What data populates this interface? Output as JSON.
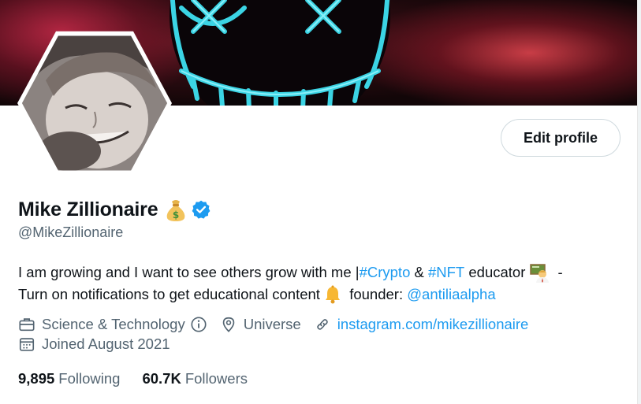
{
  "profile": {
    "display_name": "Mike Zillionaire",
    "handle": "@MikeZillionaire",
    "edit_button_label": "Edit profile",
    "name_emoji_icon": "money-bag-emoji",
    "verified_icon": "verified-badge-icon"
  },
  "bio": {
    "line1_text1": "I am growing and I want to see others grow with me | ",
    "hashtag_crypto": "#Crypto",
    "amp": " & ",
    "hashtag_nft": "#NFT",
    "line1_text2": " educator",
    "line1_emoji_icon": "teacher-emoji",
    "line1_text3": " -",
    "line2_text1": "Turn on notifications to get educational content ",
    "line2_emoji_icon": "bell-emoji",
    "line2_text2": " founder: ",
    "mention": "@antiliaalpha"
  },
  "meta": {
    "category": "Science & Technology",
    "location": "Universe",
    "website": "instagram.com/mikezillionaire",
    "joined": "Joined August 2021"
  },
  "stats": {
    "following_count": "9,895",
    "following_label": "Following",
    "followers_count": "60.7K",
    "followers_label": "Followers"
  },
  "colors": {
    "link": "#1d9bf0",
    "secondary_text": "#536471",
    "primary_text": "#0f1419",
    "verified": "#1d9bf0"
  }
}
